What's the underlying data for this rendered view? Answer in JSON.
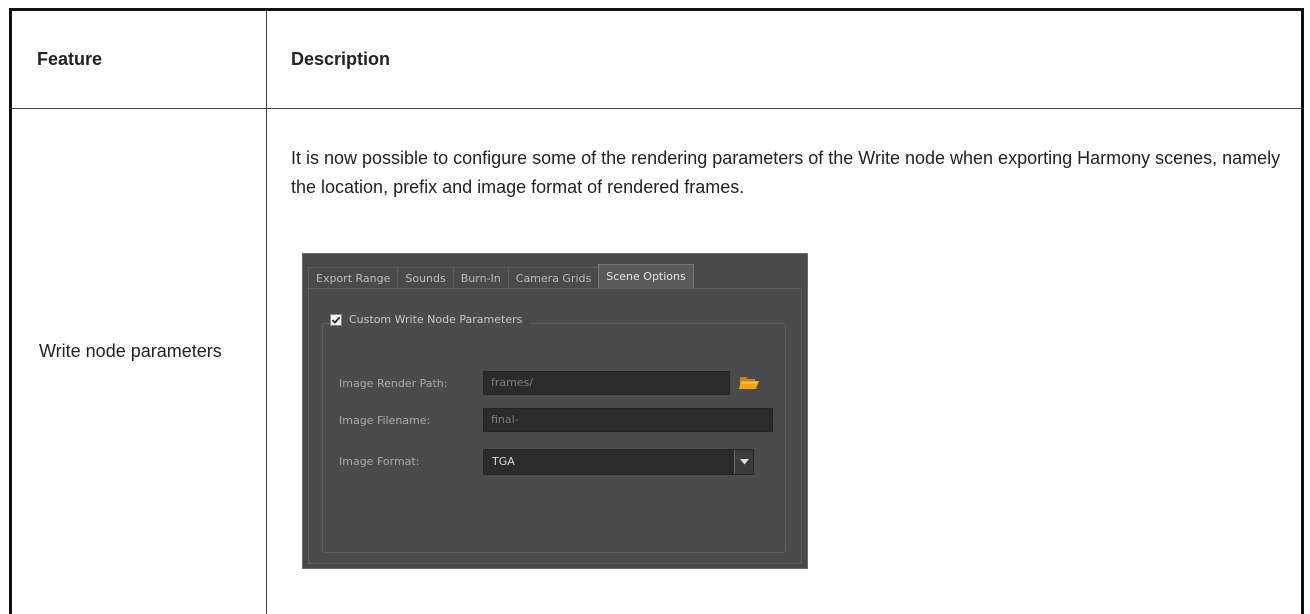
{
  "table": {
    "headers": {
      "feature": "Feature",
      "description": "Description"
    },
    "row": {
      "feature": "Write node parameters",
      "description": "It is now possible to configure some of the rendering parameters of the Write node when exporting Harmony scenes, namely the location, prefix and image format of rendered frames."
    }
  },
  "dialog": {
    "tabs": [
      {
        "label": "Export Range",
        "active": false
      },
      {
        "label": "Sounds",
        "active": false
      },
      {
        "label": "Burn-In",
        "active": false
      },
      {
        "label": "Camera Grids",
        "active": false
      },
      {
        "label": "Scene Options",
        "active": true
      }
    ],
    "group": {
      "checkbox_checked": true,
      "title": "Custom Write Node Parameters"
    },
    "fields": {
      "render_path": {
        "label": "Image Render Path:",
        "value": "frames/"
      },
      "filename": {
        "label": "Image Filename:",
        "value": "final-"
      },
      "format": {
        "label": "Image Format:",
        "value": "TGA"
      }
    },
    "icons": {
      "browse": "folder-icon",
      "dropdown": "chevron-down-icon",
      "check": "checkmark-icon"
    },
    "colors": {
      "folder": "#f2a413",
      "background": "#494949"
    }
  }
}
